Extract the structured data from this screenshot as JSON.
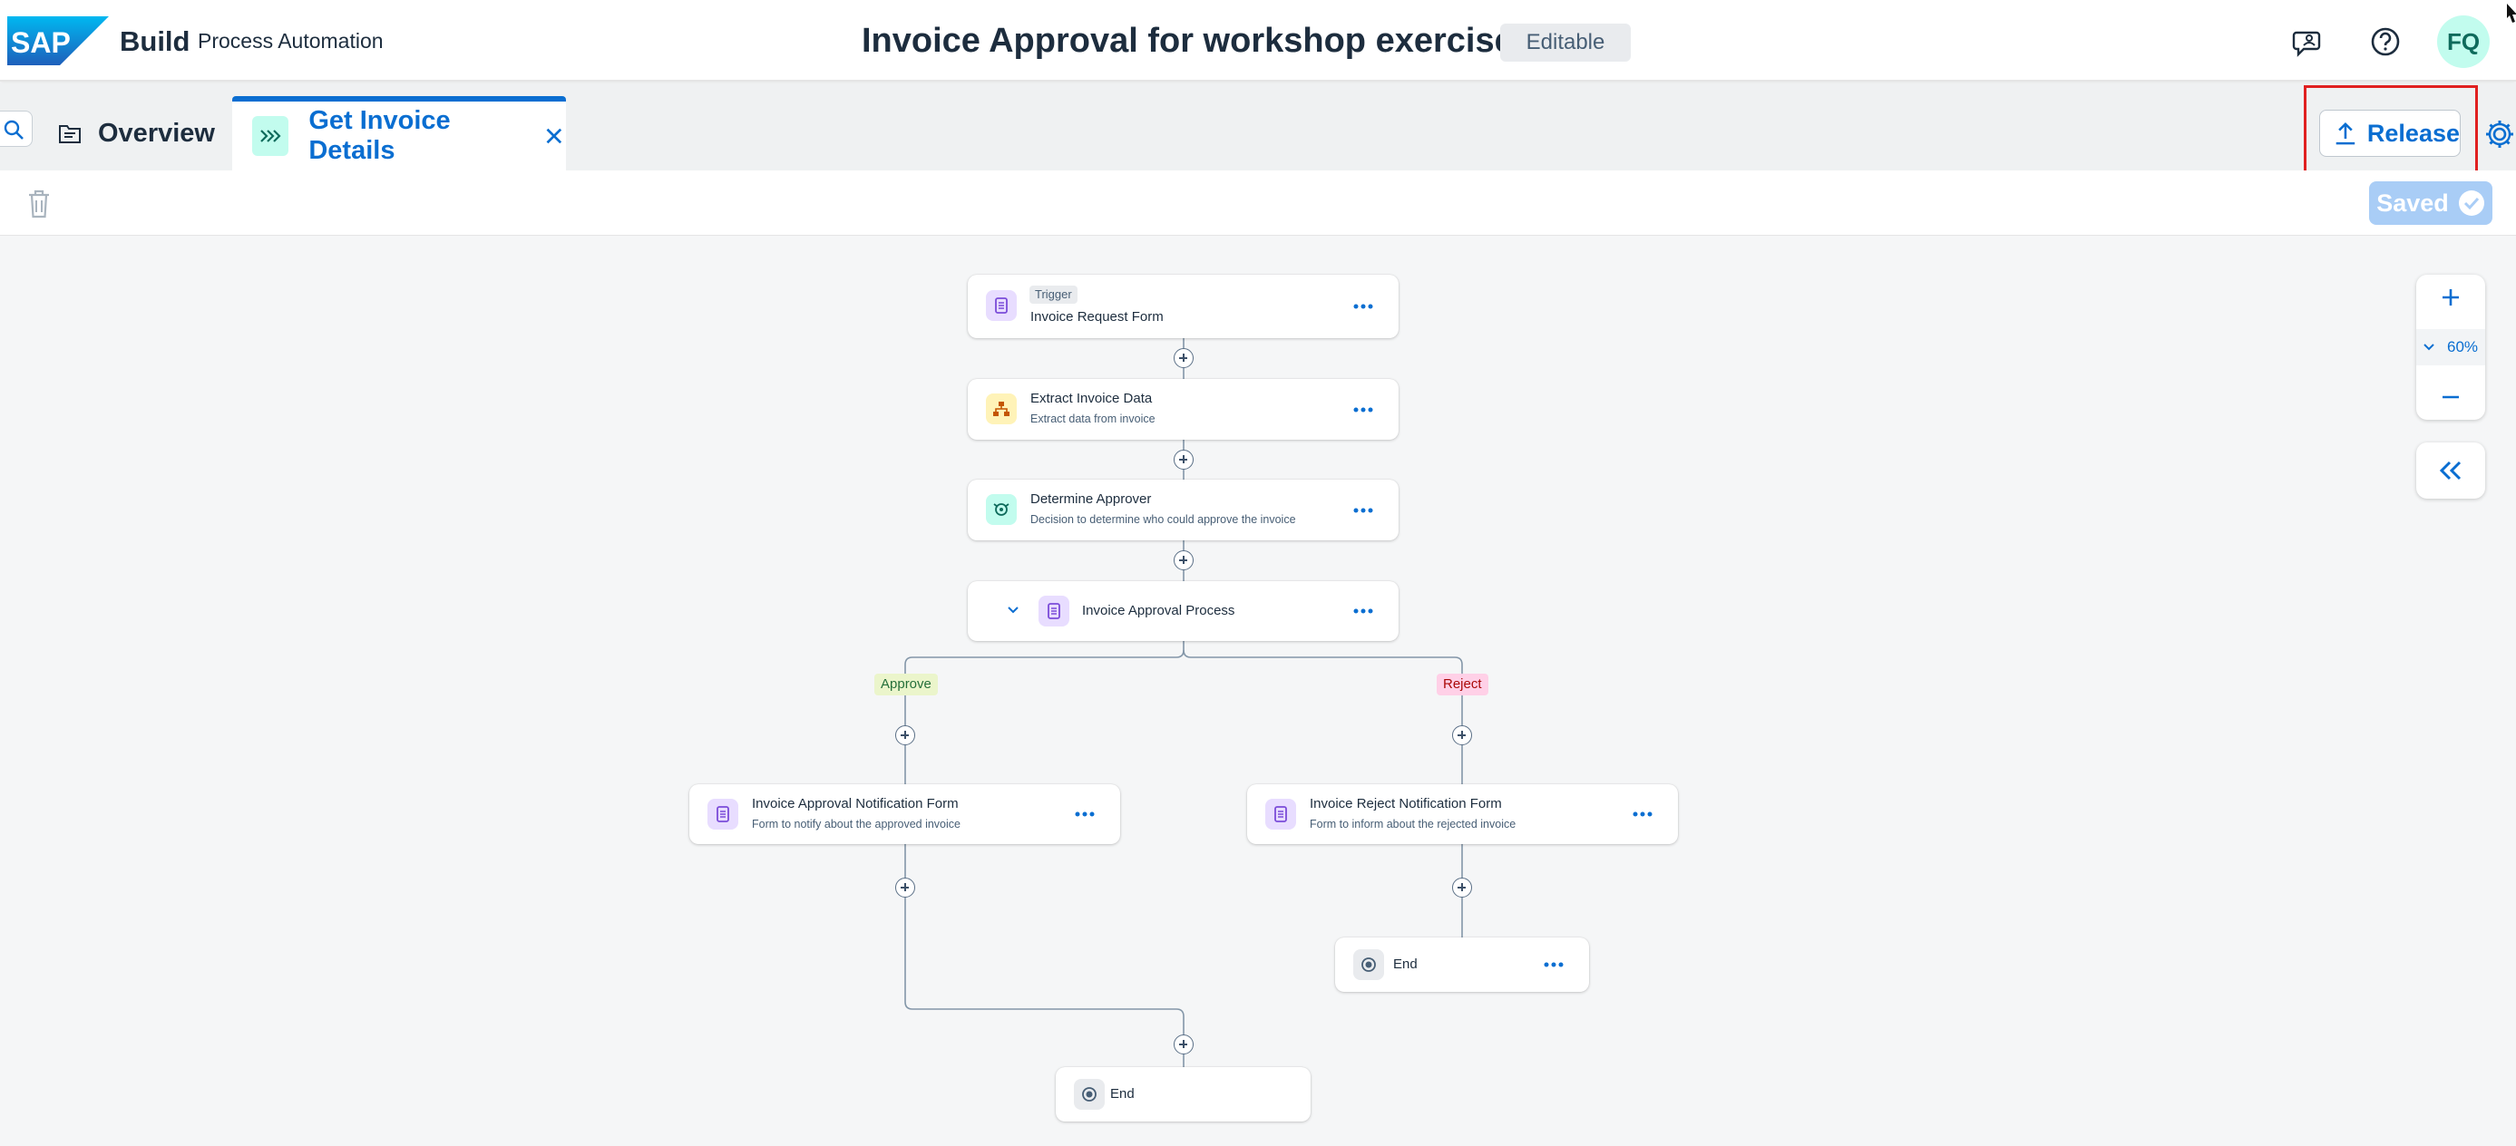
{
  "shell": {
    "logo_text": "SAP",
    "product": "Build",
    "product_sub": "Process Automation",
    "title": "Invoice Approval for workshop exercise",
    "status_badge": "Editable",
    "avatar": "FQ",
    "icons": [
      "feedback-icon",
      "help-icon"
    ]
  },
  "tabs": {
    "overview": "Overview",
    "active": "Get Invoice Details"
  },
  "toolbar": {
    "release": "Release",
    "saved": "Saved"
  },
  "flow": {
    "trigger": {
      "badge": "Trigger",
      "title": "Invoice Request Form"
    },
    "extract": {
      "title": "Extract Invoice Data",
      "sub": "Extract data from invoice"
    },
    "determine": {
      "title": "Determine Approver",
      "sub": "Decision to determine who could approve the invoice"
    },
    "approval_process": {
      "title": "Invoice Approval Process"
    },
    "branch_approve": "Approve",
    "branch_reject": "Reject",
    "approve_form": {
      "title": "Invoice Approval Notification Form",
      "sub": "Form to notify about the approved invoice"
    },
    "reject_form": {
      "title": "Invoice Reject Notification Form",
      "sub": "Form to inform about the rejected invoice"
    },
    "end_reject": "End",
    "end_main": "End"
  },
  "zoom": {
    "level": "60%"
  },
  "colors": {
    "accent": "#0a6ed1",
    "highlight": "#e02020",
    "form_icon_bg": "#e8ddff",
    "automation_icon_bg": "#fff3b8",
    "decision_icon_bg": "#c2fcee"
  }
}
